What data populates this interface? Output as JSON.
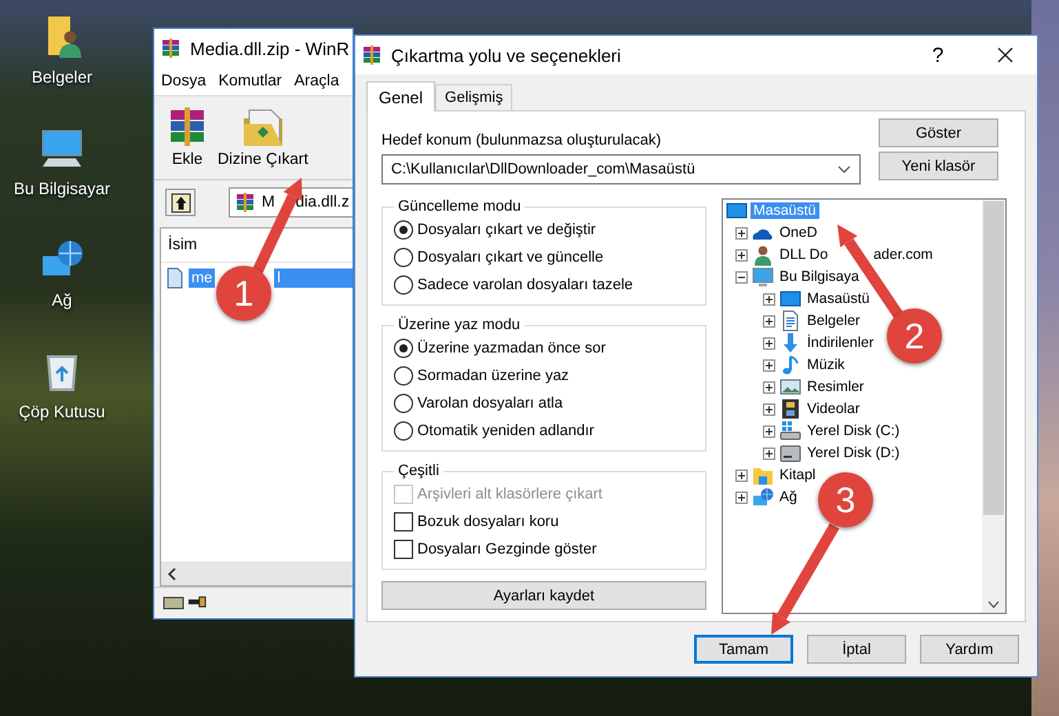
{
  "desktop": {
    "icons": [
      {
        "label": "Belgeler",
        "kind": "user-folder"
      },
      {
        "label": "Bu Bilgisayar",
        "kind": "computer"
      },
      {
        "label": "Ağ",
        "kind": "network"
      },
      {
        "label": "Çöp Kutusu",
        "kind": "recycle-bin"
      }
    ]
  },
  "archiver_window": {
    "title": "Media.dll.zip - WinR",
    "menu": [
      "Dosya",
      "Komutlar",
      "Araçla"
    ],
    "toolbar": [
      {
        "label": "Ekle",
        "kind": "add"
      },
      {
        "label": "Dizine Çıkart",
        "kind": "extract"
      }
    ],
    "address": {
      "value": "M",
      "value_after": "dia.dll.z"
    },
    "column": "İsim",
    "rows": [
      {
        "name": "me",
        "name_after": "l",
        "selected": true
      }
    ]
  },
  "dialog": {
    "title": "Çıkartma yolu ve seçenekleri",
    "help_button": "?",
    "tabs": [
      {
        "label": "Genel",
        "selected": true
      },
      {
        "label": "Gelişmiş",
        "selected": false
      }
    ],
    "destination_label": "Hedef konum (bulunmazsa oluşturulacak)",
    "destination": "C:\\Kullanıcılar\\DllDownloader_com\\Masaüstü",
    "side_buttons": [
      "Göster",
      "Yeni klasör"
    ],
    "groups": [
      {
        "title": "Güncelleme modu",
        "kind": "radio",
        "options": [
          {
            "label": "Dosyaları çıkart ve değiştir",
            "selected": true
          },
          {
            "label": "Dosyaları çıkart ve güncelle",
            "selected": false
          },
          {
            "label": "Sadece varolan dosyaları tazele",
            "selected": false
          }
        ]
      },
      {
        "title": "Üzerine yaz modu",
        "kind": "radio",
        "options": [
          {
            "label": "Üzerine yazmadan önce sor",
            "selected": true
          },
          {
            "label": "Sormadan üzerine yaz",
            "selected": false
          },
          {
            "label": "Varolan dosyaları atla",
            "selected": false
          },
          {
            "label": "Otomatik yeniden adlandır",
            "selected": false
          }
        ]
      },
      {
        "title": "Çeşitli",
        "kind": "checkbox",
        "options": [
          {
            "label": "Arşivleri alt klasörlere çıkart",
            "checked": false,
            "disabled": true
          },
          {
            "label": "Bozuk dosyaları koru",
            "checked": false,
            "disabled": false
          },
          {
            "label": "Dosyaları Gezginde göster",
            "checked": false,
            "disabled": false
          }
        ]
      }
    ],
    "save_button": "Ayarları kaydet",
    "tree": [
      {
        "label": "Masaüstü",
        "kind": "desktop",
        "selected": true,
        "children": [
          {
            "label": "OneD",
            "kind": "cloud",
            "expanded": false,
            "selected": false
          },
          {
            "label": "DLL Do",
            "label_after": "ader.com",
            "kind": "user",
            "expanded": false,
            "selected": false
          },
          {
            "label": "Bu Bilgisaya",
            "kind": "pc",
            "expanded": true,
            "selected": false,
            "children": [
              {
                "label": "Masaüstü",
                "kind": "desktop",
                "expanded": false,
                "selected": false
              },
              {
                "label": "Belgeler",
                "kind": "docs",
                "expanded": false,
                "selected": false
              },
              {
                "label": "İndirilenler",
                "kind": "download",
                "expanded": false,
                "selected": false
              },
              {
                "label": "Müzik",
                "kind": "music",
                "expanded": false,
                "selected": false
              },
              {
                "label": "Resimler",
                "kind": "pictures",
                "expanded": false,
                "selected": false
              },
              {
                "label": "Videolar",
                "kind": "video",
                "expanded": false,
                "selected": false
              },
              {
                "label": "Yerel Disk (C:)",
                "kind": "disk-win",
                "expanded": false,
                "selected": false
              },
              {
                "label": "Yerel Disk (D:)",
                "kind": "disk",
                "expanded": false,
                "selected": false
              }
            ]
          },
          {
            "label": "Kitapl",
            "kind": "library",
            "expanded": false,
            "selected": false
          },
          {
            "label": "Ağ",
            "kind": "network",
            "expanded": false,
            "selected": false
          }
        ]
      }
    ],
    "buttons": [
      {
        "label": "Tamam",
        "default": true
      },
      {
        "label": "İptal",
        "default": false
      },
      {
        "label": "Yardım",
        "default": false
      }
    ]
  },
  "annotations": [
    {
      "number": "1"
    },
    {
      "number": "2"
    },
    {
      "number": "3"
    }
  ]
}
